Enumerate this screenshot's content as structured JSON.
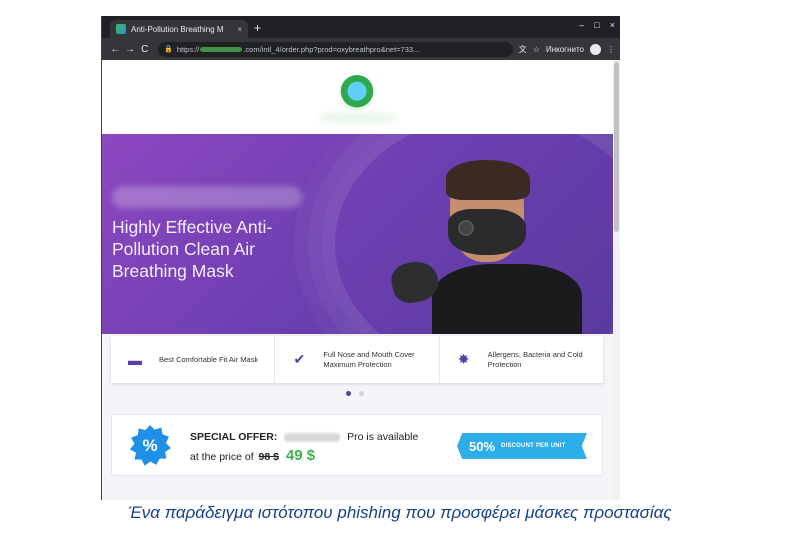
{
  "browser": {
    "tab_title": "Anti-Pollution Breathing M",
    "tab_close": "×",
    "new_tab": "+",
    "win_min": "–",
    "win_max": "□",
    "win_close": "×",
    "back": "←",
    "forward": "→",
    "reload": "C",
    "url_prefix": "https://",
    "url_suffix": ".com/intl_4/order.php?prod=oxybreathpro&net=733...",
    "incognito_label": "Инкогнито",
    "menu": "⋮"
  },
  "hero": {
    "title": "Highly Effective Anti-Pollution Clean Air Breathing Mask"
  },
  "features": [
    {
      "icon": "mask-icon",
      "glyph": "▬",
      "text": "Best Comfortable Fit Air Mask"
    },
    {
      "icon": "checkmark-icon",
      "glyph": "✔",
      "text": "Full Nose and Mouth Cover Maximum Protection"
    },
    {
      "icon": "virus-icon",
      "glyph": "✸",
      "text": "Allergens, Bacteria and Cold Protection"
    }
  ],
  "offer": {
    "badge": "%",
    "label": "SPECIAL OFFER:",
    "available_text": "Pro is available",
    "price_prefix": "at the price of",
    "old_price": "98 $",
    "new_price": "49 $",
    "discount_percent": "50%",
    "discount_label": "DISCOUNT PER UNIT"
  },
  "caption": "Ένα παράδειγμα ιστότοπου phishing που προσφέρει μάσκες προστασίας",
  "colors": {
    "hero_purple": "#7a42b8",
    "accent_blue": "#2eaee8",
    "price_green": "#3cb34a"
  }
}
